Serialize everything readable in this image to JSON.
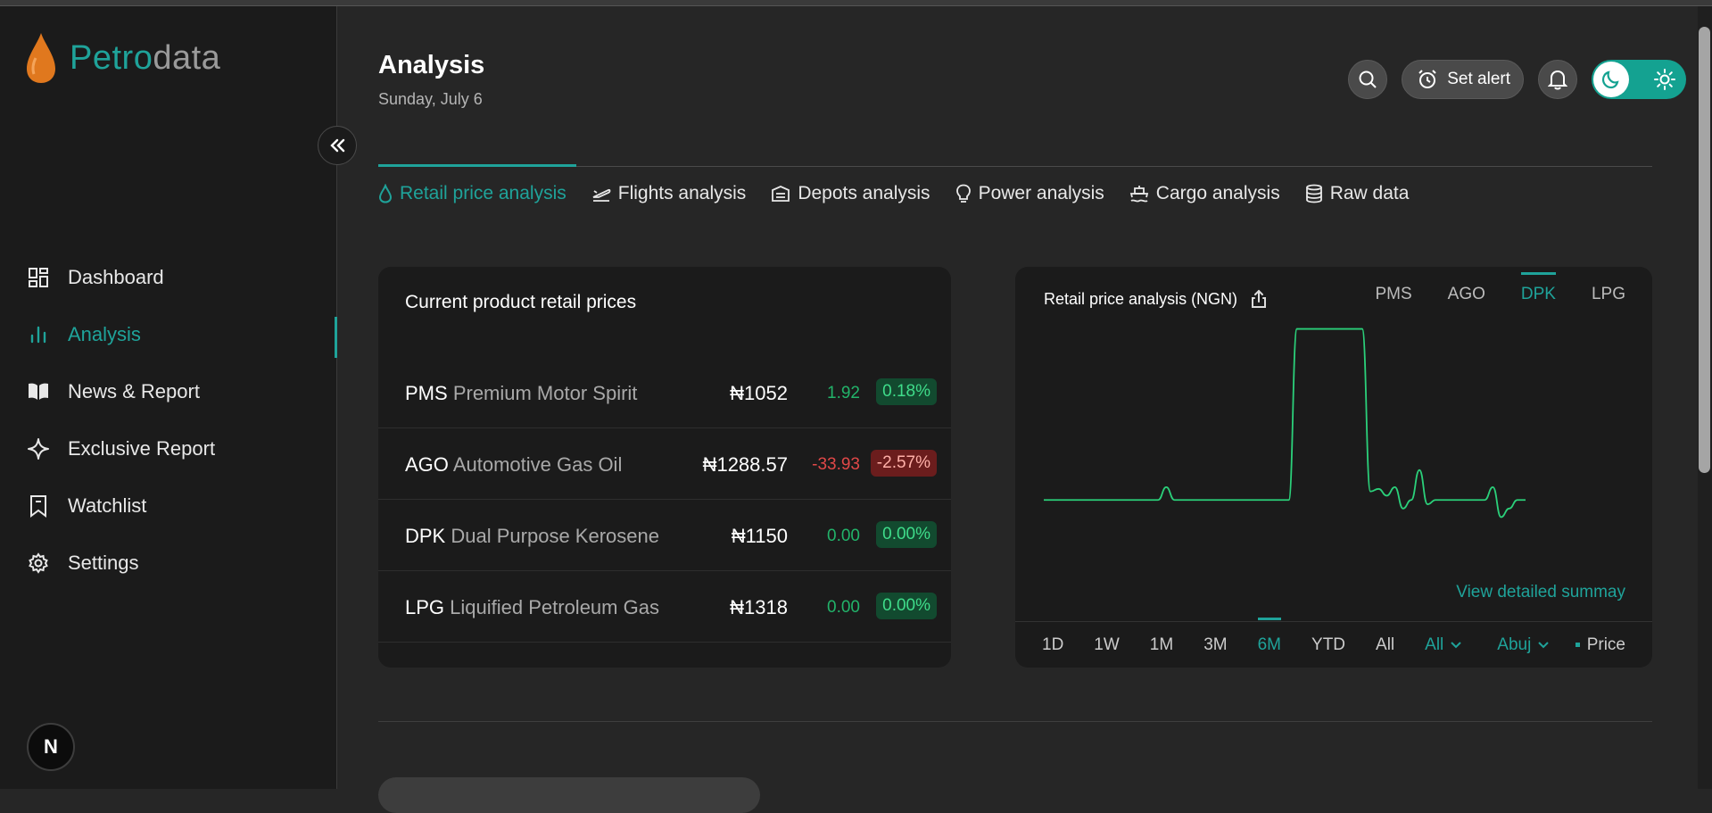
{
  "app": {
    "logo_part1": "Petro",
    "logo_part2": "data"
  },
  "sidebar": {
    "items": [
      {
        "label": "Dashboard",
        "icon": "grid-icon",
        "active": false
      },
      {
        "label": "Analysis",
        "icon": "bar-chart-icon",
        "active": true
      },
      {
        "label": "News & Report",
        "icon": "book-icon",
        "active": false
      },
      {
        "label": "Exclusive Report",
        "icon": "sparkle-icon",
        "active": false
      },
      {
        "label": "Watchlist",
        "icon": "bookmark-icon",
        "active": false
      },
      {
        "label": "Settings",
        "icon": "gear-icon",
        "active": false
      }
    ],
    "avatar_letter": "N"
  },
  "header": {
    "title": "Analysis",
    "date": "Sunday, July 6",
    "set_alert_label": "Set alert"
  },
  "tabs": [
    {
      "label": "Retail price analysis",
      "icon": "drop-icon",
      "active": true
    },
    {
      "label": "Flights analysis",
      "icon": "plane-icon",
      "active": false
    },
    {
      "label": "Depots analysis",
      "icon": "warehouse-icon",
      "active": false
    },
    {
      "label": "Power analysis",
      "icon": "bulb-icon",
      "active": false
    },
    {
      "label": "Cargo analysis",
      "icon": "ship-icon",
      "active": false
    },
    {
      "label": "Raw data",
      "icon": "database-icon",
      "active": false
    }
  ],
  "prices_card": {
    "title": "Current product retail prices",
    "rows": [
      {
        "code": "PMS",
        "name": "Premium Motor Spirit",
        "price": "₦1052",
        "change": "1.92",
        "percent": "0.18%",
        "trend": "up"
      },
      {
        "code": "AGO",
        "name": "Automotive Gas Oil",
        "price": "₦1288.57",
        "change": "-33.93",
        "percent": "-2.57%",
        "trend": "down"
      },
      {
        "code": "DPK",
        "name": "Dual Purpose Kerosene",
        "price": "₦1150",
        "change": "0.00",
        "percent": "0.00%",
        "trend": "up"
      },
      {
        "code": "LPG",
        "name": "Liquified Petroleum Gas",
        "price": "₦1318",
        "change": "0.00",
        "percent": "0.00%",
        "trend": "up"
      }
    ]
  },
  "chart_card": {
    "title": "Retail price analysis (NGN)",
    "products": [
      "PMS",
      "AGO",
      "DPK",
      "LPG"
    ],
    "active_product": "DPK",
    "view_link": "View detailed summay",
    "ranges": [
      "1D",
      "1W",
      "1M",
      "3M",
      "6M",
      "YTD",
      "All"
    ],
    "active_range": "6M",
    "filter_all": "All",
    "filter_location": "Abuj",
    "legend_label": "Price"
  },
  "chart_data": {
    "type": "line",
    "title": "Retail price analysis (NGN)",
    "series": [
      {
        "name": "Price",
        "values": [
          1150,
          1150,
          1150,
          1150,
          1150,
          1150,
          1150,
          1150,
          1150,
          1150,
          1150,
          1150,
          1150,
          1150,
          1150,
          1165,
          1150,
          1150,
          1150,
          1150,
          1150,
          1150,
          1150,
          1150,
          1150,
          1150,
          1150,
          1150,
          1150,
          1150,
          1150,
          1350,
          1350,
          1350,
          1350,
          1350,
          1350,
          1350,
          1350,
          1350,
          1160,
          1163,
          1155,
          1165,
          1140,
          1150,
          1185,
          1145,
          1150,
          1150,
          1150,
          1150,
          1150,
          1150,
          1150,
          1165,
          1130,
          1140,
          1150,
          1150
        ]
      }
    ],
    "ylim": [
      1120,
      1360
    ],
    "grid": false,
    "color": "#2bd07a"
  }
}
